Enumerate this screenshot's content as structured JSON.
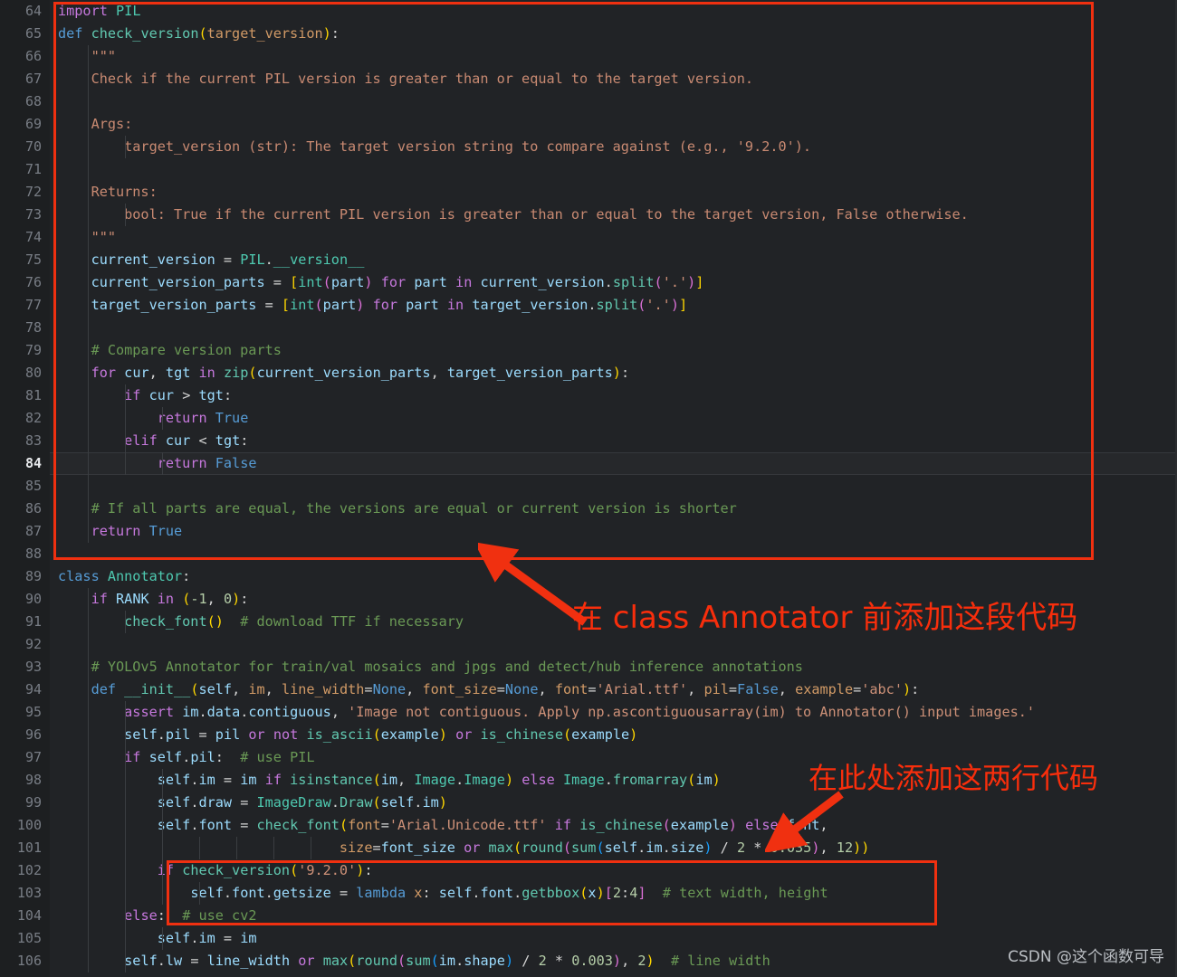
{
  "editor": {
    "first_line_number": 64,
    "last_line_number": 106,
    "active_line_number": 84,
    "background_color": "#212326",
    "gutter_color": "#1d1f21",
    "language": "Python"
  },
  "line_numbers": [
    "64",
    "65",
    "66",
    "67",
    "68",
    "69",
    "70",
    "71",
    "72",
    "73",
    "74",
    "75",
    "76",
    "77",
    "78",
    "79",
    "80",
    "81",
    "82",
    "83",
    "84",
    "85",
    "86",
    "87",
    "88",
    "89",
    "90",
    "91",
    "92",
    "93",
    "94",
    "95",
    "96",
    "97",
    "98",
    "99",
    "100",
    "101",
    "102",
    "103",
    "104",
    "105",
    "106"
  ],
  "code_lines": [
    "import PIL",
    "def check_version(target_version):",
    "    \"\"\"",
    "    Check if the current PIL version is greater than or equal to the target version.",
    "",
    "    Args:",
    "        target_version (str): The target version string to compare against (e.g., '9.2.0').",
    "",
    "    Returns:",
    "        bool: True if the current PIL version is greater than or equal to the target version, False otherwise.",
    "    \"\"\"",
    "    current_version = PIL.__version__",
    "    current_version_parts = [int(part) for part in current_version.split('.')]",
    "    target_version_parts = [int(part) for part in target_version.split('.')]",
    "",
    "    # Compare version parts",
    "    for cur, tgt in zip(current_version_parts, target_version_parts):",
    "        if cur > tgt:",
    "            return True",
    "        elif cur < tgt:",
    "            return False",
    "",
    "    # If all parts are equal, the versions are equal or current version is shorter",
    "    return True",
    "",
    "class Annotator:",
    "    if RANK in (-1, 0):",
    "        check_font()  # download TTF if necessary",
    "",
    "    # YOLOv5 Annotator for train/val mosaics and jpgs and detect/hub inference annotations",
    "    def __init__(self, im, line_width=None, font_size=None, font='Arial.ttf', pil=False, example='abc'):",
    "        assert im.data.contiguous, 'Image not contiguous. Apply np.ascontiguousarray(im) to Annotator() input images.'",
    "        self.pil = pil or not is_ascii(example) or is_chinese(example)",
    "        if self.pil:  # use PIL",
    "            self.im = im if isinstance(im, Image.Image) else Image.fromarray(im)",
    "            self.draw = ImageDraw.Draw(self.im)",
    "            self.font = check_font(font='Arial.Unicode.ttf' if is_chinese(example) else font,",
    "                                  size=font_size or max(round(sum(self.im.size) / 2 * 0.035), 12))",
    "            if check_version('9.2.0'):",
    "                self.font.getsize = lambda x: self.font.getbbox(x)[2:4]  # text width, height",
    "        else:  # use cv2",
    "            self.im = im",
    "        self.lw = line_width or max(round(sum(im.shape) / 2 * 0.003), 2)  # line width"
  ],
  "annotations": {
    "color": "#f82e0c",
    "box_color": "#f03010",
    "note_1": "在 class Annotator 前添加这段代码",
    "note_2": "在此处添加这两行代码",
    "arrow_1_name": "arrow-pointing-to-code-block-1",
    "arrow_2_name": "arrow-pointing-to-code-block-2"
  },
  "watermark": {
    "text": "CSDN @这个函数可导"
  }
}
